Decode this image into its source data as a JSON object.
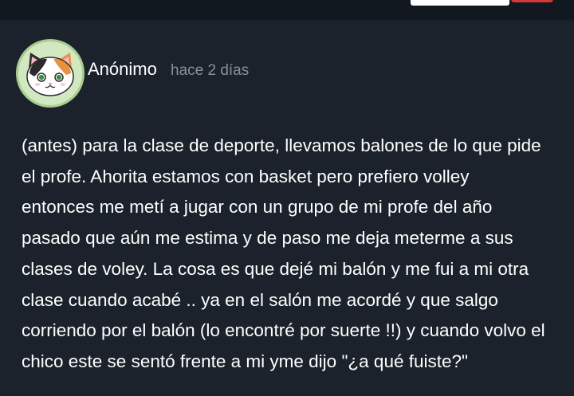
{
  "post": {
    "author": "Anónimo",
    "time": "hace 2 días",
    "avatar_icon": "calico-cat-icon",
    "body_lines": [
      "(antes) para la clase de deporte, llevamos balones de lo que pide",
      "el profe. Ahorita estamos con basket pero prefiero volley",
      "entonces me metí a jugar con un grupo de mi profe del año",
      "pasado que aún me estima y de paso me deja meterme a sus",
      "clases de voley. La cosa es que dejé mi balón y me fui a mi otra",
      "clase cuando acabé .. ya en el salón me acordé y que salgo",
      "corriendo por el balón (lo encontré por suerte !!) y cuando volvo el",
      "chico este se sentó frente a mi yme dijo \"¿a qué fuiste?\""
    ]
  },
  "colors": {
    "background": "#161d26",
    "card": "#1b222c",
    "text": "#ffffff",
    "muted": "#8b9098",
    "avatar_bg": "#d2e8c0",
    "accent_red": "#d23a3a"
  }
}
